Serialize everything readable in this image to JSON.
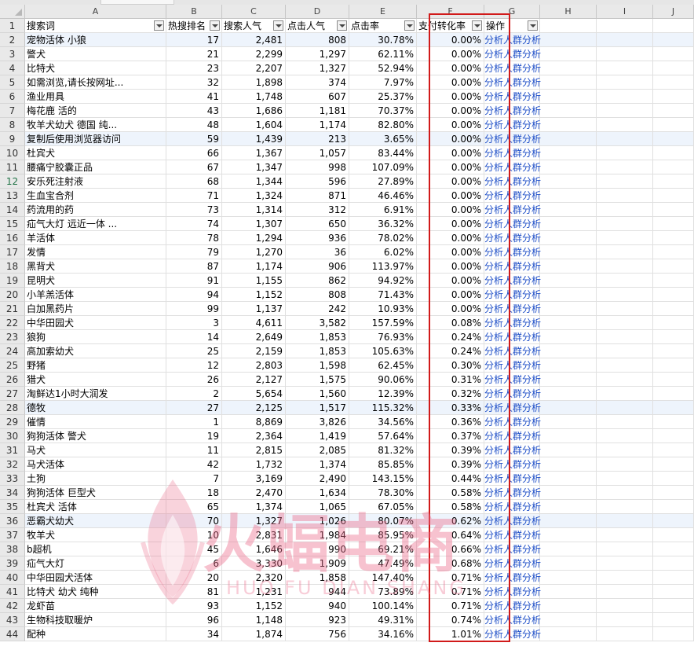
{
  "columns": [
    "A",
    "B",
    "C",
    "D",
    "E",
    "F",
    "G",
    "H",
    "I",
    "J"
  ],
  "headers": {
    "keyword": "搜索词",
    "rank": "热搜排名",
    "search": "搜索人气",
    "click": "点击人气",
    "ctr": "点击率",
    "conv": "支付转化率",
    "op": "操作"
  },
  "link_text": "分析人群分析",
  "rows": [
    {
      "k": "宠物活体 小狼",
      "b": "17",
      "c": "2,481",
      "d": "808",
      "e": "30.78%",
      "f": "0.00%"
    },
    {
      "k": "警犬",
      "b": "21",
      "c": "2,299",
      "d": "1,297",
      "e": "62.11%",
      "f": "0.00%"
    },
    {
      "k": "比特犬",
      "b": "23",
      "c": "2,207",
      "d": "1,327",
      "e": "52.94%",
      "f": "0.00%"
    },
    {
      "k": "如需浏览,请长按网址...",
      "b": "32",
      "c": "1,898",
      "d": "374",
      "e": "7.97%",
      "f": "0.00%"
    },
    {
      "k": "渔业用具",
      "b": "41",
      "c": "1,748",
      "d": "607",
      "e": "25.37%",
      "f": "0.00%"
    },
    {
      "k": "梅花鹿 活的",
      "b": "43",
      "c": "1,686",
      "d": "1,181",
      "e": "70.37%",
      "f": "0.00%"
    },
    {
      "k": "牧羊犬幼犬 德国 纯...",
      "b": "48",
      "c": "1,604",
      "d": "1,174",
      "e": "82.80%",
      "f": "0.00%"
    },
    {
      "k": "复制后使用浏览器访问",
      "b": "59",
      "c": "1,439",
      "d": "213",
      "e": "3.65%",
      "f": "0.00%"
    },
    {
      "k": "杜宾犬",
      "b": "66",
      "c": "1,367",
      "d": "1,057",
      "e": "83.44%",
      "f": "0.00%"
    },
    {
      "k": "腰痛宁胶囊正品",
      "b": "67",
      "c": "1,347",
      "d": "998",
      "e": "107.09%",
      "f": "0.00%"
    },
    {
      "k": "安乐死注射液",
      "b": "68",
      "c": "1,344",
      "d": "596",
      "e": "27.89%",
      "f": "0.00%"
    },
    {
      "k": "生血宝合剂",
      "b": "71",
      "c": "1,324",
      "d": "871",
      "e": "46.46%",
      "f": "0.00%"
    },
    {
      "k": "药流用的药",
      "b": "73",
      "c": "1,314",
      "d": "312",
      "e": "6.91%",
      "f": "0.00%"
    },
    {
      "k": "疝气大灯 远近一体 ...",
      "b": "74",
      "c": "1,307",
      "d": "650",
      "e": "36.32%",
      "f": "0.00%"
    },
    {
      "k": "羊活体",
      "b": "78",
      "c": "1,294",
      "d": "936",
      "e": "78.02%",
      "f": "0.00%"
    },
    {
      "k": "发情",
      "b": "79",
      "c": "1,270",
      "d": "36",
      "e": "6.02%",
      "f": "0.00%"
    },
    {
      "k": "黑背犬",
      "b": "87",
      "c": "1,174",
      "d": "906",
      "e": "113.97%",
      "f": "0.00%"
    },
    {
      "k": "昆明犬",
      "b": "91",
      "c": "1,155",
      "d": "862",
      "e": "94.92%",
      "f": "0.00%"
    },
    {
      "k": "小羊羔活体",
      "b": "94",
      "c": "1,152",
      "d": "808",
      "e": "71.43%",
      "f": "0.00%"
    },
    {
      "k": "白加黑药片",
      "b": "99",
      "c": "1,137",
      "d": "242",
      "e": "10.93%",
      "f": "0.00%"
    },
    {
      "k": "中华田园犬",
      "b": "3",
      "c": "4,611",
      "d": "3,582",
      "e": "157.59%",
      "f": "0.08%"
    },
    {
      "k": "狼狗",
      "b": "14",
      "c": "2,649",
      "d": "1,853",
      "e": "76.93%",
      "f": "0.24%"
    },
    {
      "k": "高加索幼犬",
      "b": "25",
      "c": "2,159",
      "d": "1,853",
      "e": "105.63%",
      "f": "0.24%"
    },
    {
      "k": "野猪",
      "b": "12",
      "c": "2,803",
      "d": "1,598",
      "e": "62.45%",
      "f": "0.30%"
    },
    {
      "k": "猎犬",
      "b": "26",
      "c": "2,127",
      "d": "1,575",
      "e": "90.06%",
      "f": "0.31%"
    },
    {
      "k": "淘鲜达1小时大润发",
      "b": "2",
      "c": "5,654",
      "d": "1,560",
      "e": "12.39%",
      "f": "0.32%"
    },
    {
      "k": "德牧",
      "b": "27",
      "c": "2,125",
      "d": "1,517",
      "e": "115.32%",
      "f": "0.33%"
    },
    {
      "k": "催情",
      "b": "1",
      "c": "8,869",
      "d": "3,826",
      "e": "34.56%",
      "f": "0.36%"
    },
    {
      "k": "狗狗活体 警犬",
      "b": "19",
      "c": "2,364",
      "d": "1,419",
      "e": "57.64%",
      "f": "0.37%"
    },
    {
      "k": "马犬",
      "b": "11",
      "c": "2,815",
      "d": "2,085",
      "e": "81.32%",
      "f": "0.39%"
    },
    {
      "k": "马犬活体",
      "b": "42",
      "c": "1,732",
      "d": "1,374",
      "e": "85.85%",
      "f": "0.39%"
    },
    {
      "k": "土狗",
      "b": "7",
      "c": "3,169",
      "d": "2,490",
      "e": "143.15%",
      "f": "0.44%"
    },
    {
      "k": "狗狗活体 巨型犬",
      "b": "18",
      "c": "2,470",
      "d": "1,634",
      "e": "78.30%",
      "f": "0.58%"
    },
    {
      "k": "杜宾犬 活体",
      "b": "65",
      "c": "1,374",
      "d": "1,065",
      "e": "67.05%",
      "f": "0.58%"
    },
    {
      "k": "恶霸犬幼犬",
      "b": "70",
      "c": "1,327",
      "d": "1,026",
      "e": "80.07%",
      "f": "0.62%"
    },
    {
      "k": "牧羊犬",
      "b": "10",
      "c": "2,831",
      "d": "1,984",
      "e": "85.95%",
      "f": "0.64%"
    },
    {
      "k": "b超机",
      "b": "45",
      "c": "1,646",
      "d": "990",
      "e": "69.21%",
      "f": "0.66%"
    },
    {
      "k": "疝气大灯",
      "b": "6",
      "c": "3,330",
      "d": "1,909",
      "e": "47.49%",
      "f": "0.68%"
    },
    {
      "k": "中华田园犬活体",
      "b": "20",
      "c": "2,320",
      "d": "1,858",
      "e": "147.40%",
      "f": "0.71%"
    },
    {
      "k": "比特犬 幼犬 纯种",
      "b": "81",
      "c": "1,231",
      "d": "944",
      "e": "73.89%",
      "f": "0.71%"
    },
    {
      "k": "龙虾苗",
      "b": "93",
      "c": "1,152",
      "d": "940",
      "e": "100.14%",
      "f": "0.71%"
    },
    {
      "k": "生物科技取暖炉",
      "b": "96",
      "c": "1,148",
      "d": "923",
      "e": "49.31%",
      "f": "0.74%"
    },
    {
      "k": "配种",
      "b": "34",
      "c": "1,874",
      "d": "756",
      "e": "34.16%",
      "f": "1.01%"
    }
  ],
  "watermark": {
    "cn": "火蝠电商",
    "en": "HUO FU DIAN SHANG"
  }
}
